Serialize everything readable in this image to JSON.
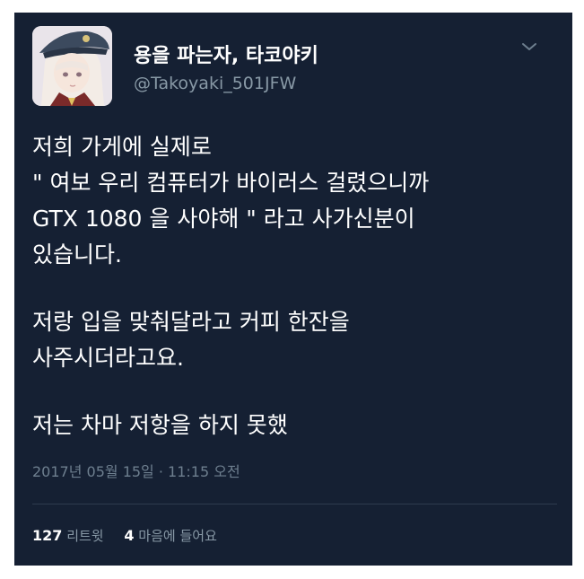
{
  "user": {
    "display_name": "용을 파는자, 타코야키",
    "handle": "@Takoyaki_501JFW",
    "avatar_icon": "anime-character-avatar"
  },
  "menu": {
    "icon": "chevron-down-icon"
  },
  "tweet": {
    "paragraphs": [
      [
        "저희 가게에 실제로",
        "\" 여보 우리 컴퓨터가 바이러스 걸렸으니까",
        "GTX 1080 을 사야해 \" 라고 사가신분이",
        "있습니다."
      ],
      [
        "저랑 입을 맞춰달라고 커피 한잔을",
        "사주시더라고요."
      ],
      [
        "저는 차마 저항을 하지 못했"
      ]
    ],
    "timestamp": "2017년 05월 15일 · 11:15 오전"
  },
  "stats": {
    "retweets_count": "127",
    "retweets_label": "리트윗",
    "likes_count": "4",
    "likes_label": "마음에 들어요"
  },
  "colors": {
    "background": "#152033",
    "text": "#ffffff",
    "muted": "#8899a6"
  }
}
